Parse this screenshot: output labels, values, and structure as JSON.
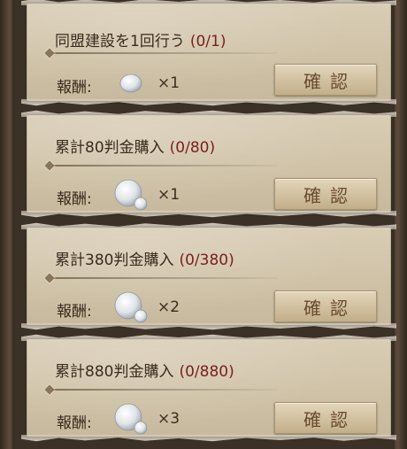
{
  "quests": [
    {
      "title": "同盟建設を1回行う",
      "progress": "(0/1)",
      "reward_label": "報酬:",
      "reward_item": "snowball-small-icon",
      "quantity": "×1",
      "button_label": "確認"
    },
    {
      "title": "累計80判金購入",
      "progress": "(0/80)",
      "reward_label": "報酬:",
      "reward_item": "snowball-large-icon",
      "quantity": "×1",
      "button_label": "確認"
    },
    {
      "title": "累計380判金購入",
      "progress": "(0/380)",
      "reward_label": "報酬:",
      "reward_item": "snowball-large-icon",
      "quantity": "×2",
      "button_label": "確認"
    },
    {
      "title": "累計880判金購入",
      "progress": "(0/880)",
      "reward_label": "報酬:",
      "reward_item": "snowball-large-icon",
      "quantity": "×3",
      "button_label": "確認"
    }
  ],
  "colors": {
    "progress_text": "#7a1f1f",
    "body_text": "#3b2c1f",
    "button_text": "#6a4b2f",
    "card_bg": "#d3c7ae"
  }
}
